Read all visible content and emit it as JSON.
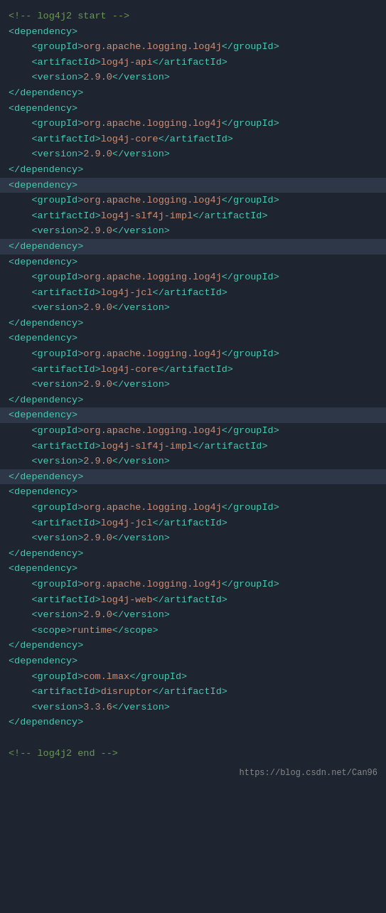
{
  "lines": [
    {
      "id": "l1",
      "text": "<!-- log4j2 start -->",
      "type": "comment",
      "indent": 0,
      "highlight": false
    },
    {
      "id": "l2",
      "text": "<dependency>",
      "type": "tag",
      "indent": 0,
      "highlight": false
    },
    {
      "id": "l3",
      "text": "    <groupId>org.apache.logging.log4j</groupId>",
      "type": "mixed",
      "indent": 1,
      "highlight": false
    },
    {
      "id": "l4",
      "text": "    <artifactId>log4j-api</artifactId>",
      "type": "mixed",
      "indent": 1,
      "highlight": false
    },
    {
      "id": "l5",
      "text": "    <version>2.9.0</version>",
      "type": "mixed",
      "indent": 1,
      "highlight": false
    },
    {
      "id": "l6",
      "text": "</dependency>",
      "type": "tag",
      "indent": 0,
      "highlight": false
    },
    {
      "id": "l7",
      "text": "<dependency>",
      "type": "tag",
      "indent": 0,
      "highlight": false
    },
    {
      "id": "l8",
      "text": "    <groupId>org.apache.logging.log4j</groupId>",
      "type": "mixed",
      "indent": 1,
      "highlight": false
    },
    {
      "id": "l9",
      "text": "    <artifactId>log4j-core</artifactId>",
      "type": "mixed",
      "indent": 1,
      "highlight": false
    },
    {
      "id": "l10",
      "text": "    <version>2.9.0</version>",
      "type": "mixed",
      "indent": 1,
      "highlight": false
    },
    {
      "id": "l11",
      "text": "</dependency>",
      "type": "tag",
      "indent": 0,
      "highlight": false
    },
    {
      "id": "l12",
      "text": "<dependency>",
      "type": "tag",
      "indent": 0,
      "highlight": true
    },
    {
      "id": "l13",
      "text": "    <groupId>org.apache.logging.log4j</groupId>",
      "type": "mixed",
      "indent": 1,
      "highlight": false
    },
    {
      "id": "l14",
      "text": "    <artifactId>log4j-slf4j-impl</artifactId>",
      "type": "mixed",
      "indent": 1,
      "highlight": false
    },
    {
      "id": "l15",
      "text": "    <version>2.9.0</version>",
      "type": "mixed",
      "indent": 1,
      "highlight": false
    },
    {
      "id": "l16",
      "text": "</dependency>",
      "type": "tag",
      "indent": 0,
      "highlight": true
    },
    {
      "id": "l17",
      "text": "<dependency>",
      "type": "tag",
      "indent": 0,
      "highlight": false
    },
    {
      "id": "l18",
      "text": "    <groupId>org.apache.logging.log4j</groupId>",
      "type": "mixed",
      "indent": 1,
      "highlight": false
    },
    {
      "id": "l19",
      "text": "    <artifactId>log4j-jcl</artifactId>",
      "type": "mixed",
      "indent": 1,
      "highlight": false
    },
    {
      "id": "l20",
      "text": "    <version>2.9.0</version>",
      "type": "mixed",
      "indent": 1,
      "highlight": false
    },
    {
      "id": "l21",
      "text": "</dependency>",
      "type": "tag",
      "indent": 0,
      "highlight": false
    },
    {
      "id": "l22",
      "text": "<dependency>",
      "type": "tag",
      "indent": 0,
      "highlight": false
    },
    {
      "id": "l23",
      "text": "    <groupId>org.apache.logging.log4j</groupId>",
      "type": "mixed",
      "indent": 1,
      "highlight": false
    },
    {
      "id": "l24",
      "text": "    <artifactId>log4j-core</artifactId>",
      "type": "mixed",
      "indent": 1,
      "highlight": false
    },
    {
      "id": "l25",
      "text": "    <version>2.9.0</version>",
      "type": "mixed",
      "indent": 1,
      "highlight": false
    },
    {
      "id": "l26",
      "text": "</dependency>",
      "type": "tag",
      "indent": 0,
      "highlight": false
    },
    {
      "id": "l27",
      "text": "<dependency>",
      "type": "tag",
      "indent": 0,
      "highlight": true
    },
    {
      "id": "l28",
      "text": "    <groupId>org.apache.logging.log4j</groupId>",
      "type": "mixed",
      "indent": 1,
      "highlight": false
    },
    {
      "id": "l29",
      "text": "    <artifactId>log4j-slf4j-impl</artifactId>",
      "type": "mixed",
      "indent": 1,
      "highlight": false
    },
    {
      "id": "l30",
      "text": "    <version>2.9.0</version>",
      "type": "mixed",
      "indent": 1,
      "highlight": false
    },
    {
      "id": "l31",
      "text": "</dependency>",
      "type": "tag",
      "indent": 0,
      "highlight": true
    },
    {
      "id": "l32",
      "text": "<dependency>",
      "type": "tag",
      "indent": 0,
      "highlight": false
    },
    {
      "id": "l33",
      "text": "    <groupId>org.apache.logging.log4j</groupId>",
      "type": "mixed",
      "indent": 1,
      "highlight": false
    },
    {
      "id": "l34",
      "text": "    <artifactId>log4j-jcl</artifactId>",
      "type": "mixed",
      "indent": 1,
      "highlight": false
    },
    {
      "id": "l35",
      "text": "    <version>2.9.0</version>",
      "type": "mixed",
      "indent": 1,
      "highlight": false
    },
    {
      "id": "l36",
      "text": "</dependency>",
      "type": "tag",
      "indent": 0,
      "highlight": false
    },
    {
      "id": "l37",
      "text": "<dependency>",
      "type": "tag",
      "indent": 0,
      "highlight": false
    },
    {
      "id": "l38",
      "text": "    <groupId>org.apache.logging.log4j</groupId>",
      "type": "mixed",
      "indent": 1,
      "highlight": false
    },
    {
      "id": "l39",
      "text": "    <artifactId>log4j-web</artifactId>",
      "type": "mixed",
      "indent": 1,
      "highlight": false
    },
    {
      "id": "l40",
      "text": "    <version>2.9.0</version>",
      "type": "mixed",
      "indent": 1,
      "highlight": false
    },
    {
      "id": "l41",
      "text": "    <scope>runtime</scope>",
      "type": "mixed",
      "indent": 1,
      "highlight": false
    },
    {
      "id": "l42",
      "text": "</dependency>",
      "type": "tag",
      "indent": 0,
      "highlight": false
    },
    {
      "id": "l43",
      "text": "<dependency>",
      "type": "tag",
      "indent": 0,
      "highlight": false
    },
    {
      "id": "l44",
      "text": "    <groupId>com.lmax</groupId>",
      "type": "mixed",
      "indent": 1,
      "highlight": false
    },
    {
      "id": "l45",
      "text": "    <artifactId>disruptor</artifactId>",
      "type": "mixed",
      "indent": 1,
      "highlight": false
    },
    {
      "id": "l46",
      "text": "    <version>3.3.6</version>",
      "type": "mixed",
      "indent": 1,
      "highlight": false
    },
    {
      "id": "l47",
      "text": "</dependency>",
      "type": "tag",
      "indent": 0,
      "highlight": false
    },
    {
      "id": "l48",
      "text": "",
      "type": "plain",
      "indent": 0,
      "highlight": false
    },
    {
      "id": "l49",
      "text": "<!-- log4j2 end -->",
      "type": "comment",
      "indent": 0,
      "highlight": false
    }
  ],
  "footer": {
    "url": "https://blog.csdn.net/Can96"
  }
}
